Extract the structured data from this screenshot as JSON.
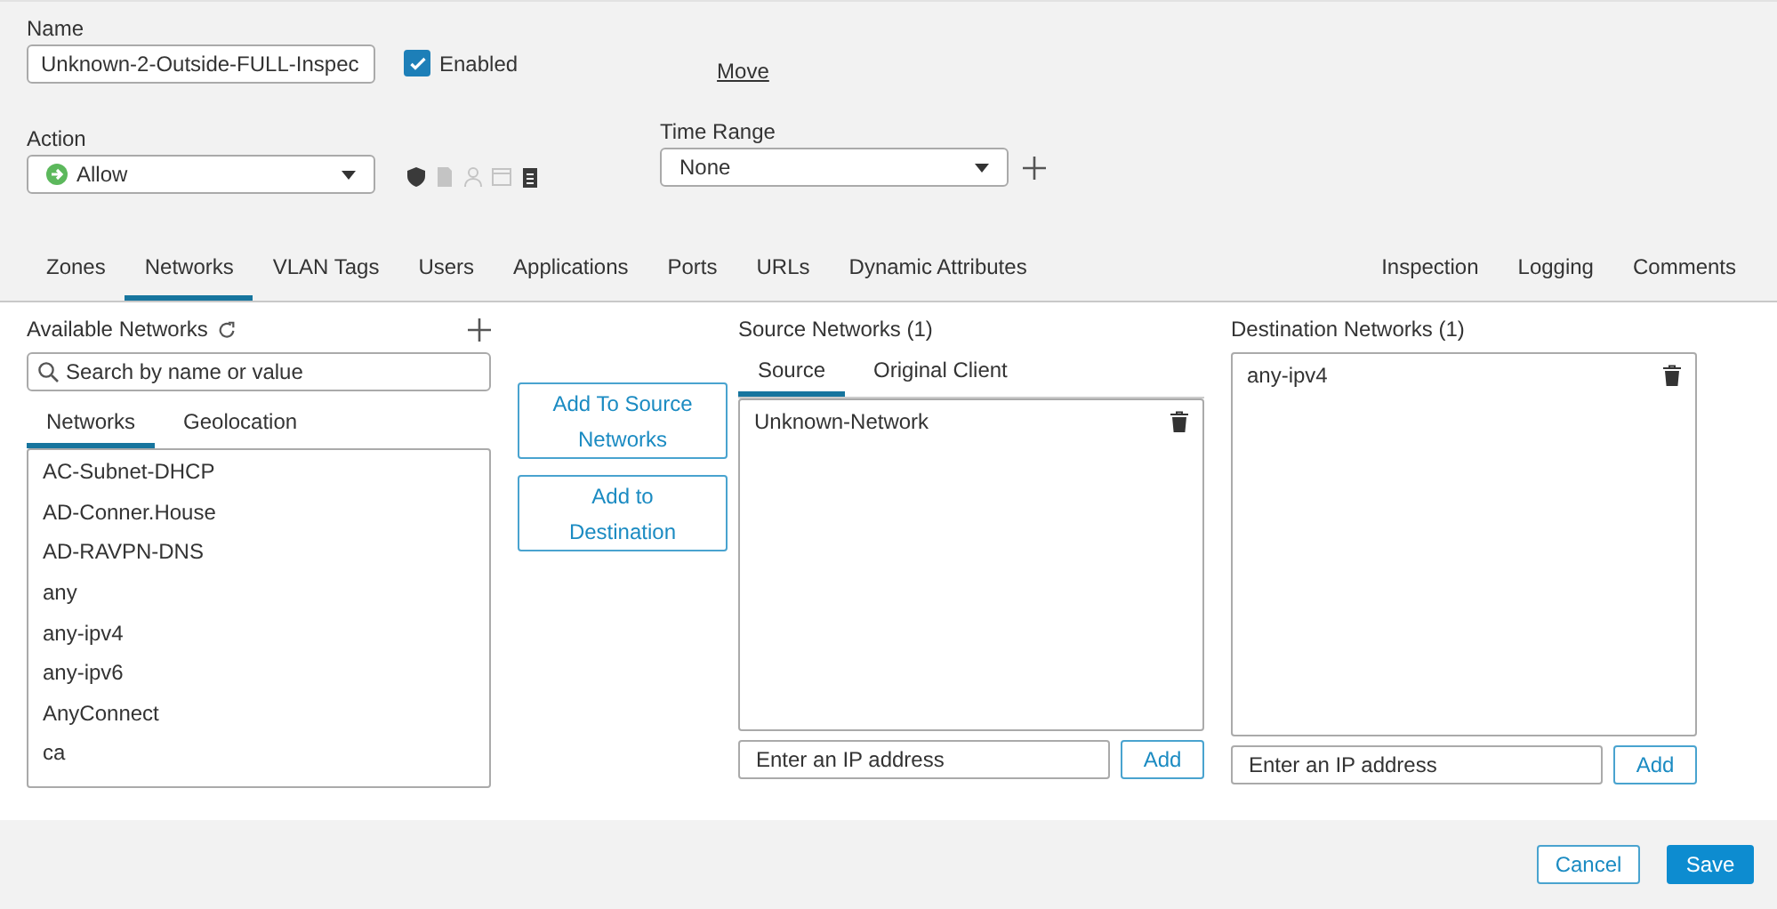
{
  "name": {
    "label": "Name",
    "value": "Unknown-2-Outside-FULL-Inspec"
  },
  "enabled": {
    "label": "Enabled",
    "checked": true
  },
  "move_link": "Move",
  "action": {
    "label": "Action",
    "value": "Allow"
  },
  "action_icons": [
    {
      "kind": "shield",
      "enabled": true
    },
    {
      "kind": "file",
      "enabled": false
    },
    {
      "kind": "user",
      "enabled": false
    },
    {
      "kind": "window",
      "enabled": false
    },
    {
      "kind": "log",
      "enabled": true
    }
  ],
  "time_range": {
    "label": "Time Range",
    "value": "None"
  },
  "tabs": [
    {
      "label": "Zones",
      "selected": false
    },
    {
      "label": "Networks",
      "selected": true
    },
    {
      "label": "VLAN Tags",
      "selected": false
    },
    {
      "label": "Users",
      "selected": false
    },
    {
      "label": "Applications",
      "selected": false
    },
    {
      "label": "Ports",
      "selected": false
    },
    {
      "label": "URLs",
      "selected": false
    },
    {
      "label": "Dynamic Attributes",
      "selected": false
    }
  ],
  "right_tabs": [
    {
      "label": "Inspection",
      "selected": false
    },
    {
      "label": "Logging",
      "selected": false
    },
    {
      "label": "Comments",
      "selected": false
    }
  ],
  "available": {
    "title": "Available Networks",
    "search_placeholder": "Search by name or value",
    "subtabs": [
      {
        "label": "Networks",
        "selected": true
      },
      {
        "label": "Geolocation",
        "selected": false
      }
    ],
    "items": [
      "AC-Subnet-DHCP",
      "AD-Conner.House",
      "AD-RAVPN-DNS",
      "any",
      "any-ipv4",
      "any-ipv6",
      "AnyConnect",
      "ca"
    ]
  },
  "add_buttons": [
    "Add To Source Networks",
    "Add to Destination"
  ],
  "source": {
    "title": "Source Networks (1)",
    "subtabs": [
      {
        "label": "Source",
        "selected": true
      },
      {
        "label": "Original Client",
        "selected": false
      }
    ],
    "items": [
      "Unknown-Network"
    ],
    "ip_placeholder": "Enter an IP address",
    "add_label": "Add"
  },
  "destination": {
    "title": "Destination Networks (1)",
    "items": [
      "any-ipv4"
    ],
    "ip_placeholder": "Enter an IP address",
    "add_label": "Add"
  },
  "footer": {
    "cancel": "Cancel",
    "save": "Save"
  }
}
